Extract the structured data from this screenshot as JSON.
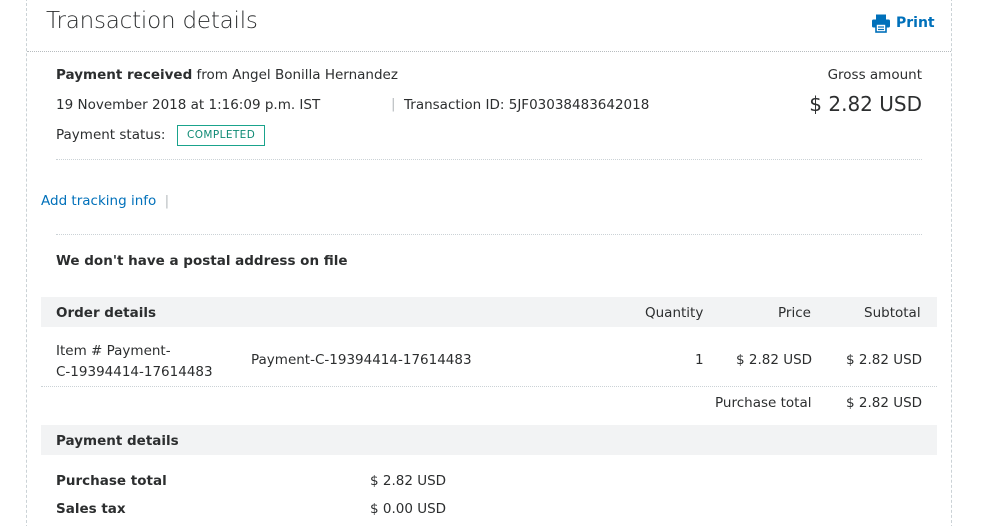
{
  "header": {
    "title": "Transaction details",
    "print_label": "Print"
  },
  "summary": {
    "payment_received_bold": "Payment received",
    "payment_from": " from Angel Bonilla Hernandez",
    "date": "19 November 2018 at 1:16:09 p.m. IST",
    "separator": "|",
    "transaction_id": "Transaction ID: 5JF03038483642018",
    "status_label": "Payment status:",
    "status_value": "COMPLETED",
    "gross_label": "Gross amount",
    "gross_amount": "$ 2.82 USD"
  },
  "tracking": {
    "link": "Add tracking info",
    "separator": "|"
  },
  "address": {
    "message": "We don't have a postal address on file"
  },
  "order": {
    "headers": {
      "details": "Order details",
      "quantity": "Quantity",
      "price": "Price",
      "subtotal": "Subtotal"
    },
    "item": {
      "item_no_line1": "Item # Payment-",
      "item_no_line2": "C-19394414-17614483",
      "name": "Payment-C-19394414-17614483",
      "quantity": "1",
      "price": "$ 2.82 USD",
      "subtotal": "$ 2.82 USD"
    },
    "purchase_total_label": "Purchase total",
    "purchase_total_value": "$ 2.82 USD"
  },
  "payment": {
    "header": "Payment details",
    "rows": [
      {
        "label": "Purchase total",
        "value": "$ 2.82 USD"
      },
      {
        "label": "Sales tax",
        "value": "$ 0.00 USD"
      }
    ]
  },
  "colors": {
    "link": "#0070ba",
    "status": "#1aa38c",
    "bar": "#f2f3f4"
  }
}
